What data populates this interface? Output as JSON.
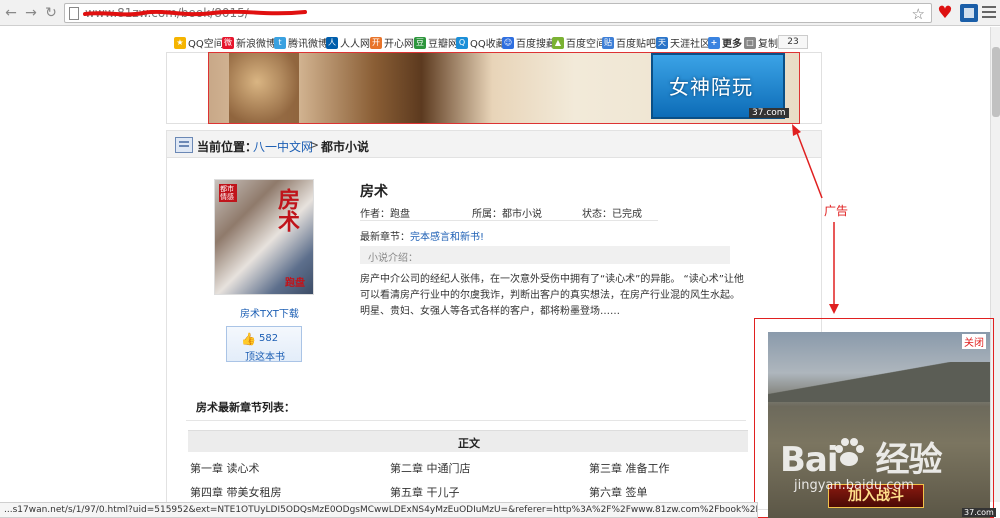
{
  "browser": {
    "url": "www.81zw.com/book/8015/",
    "status_url": "...s17wan.net/s/1/97/0.html?uid=515952&ext=NTE1OTUyLDI5ODQsMzE0ODgsMCwwLDExNS4yMzEuODIuMzU=&referer=http%3A%2F%2Fwww.81zw.com%2Fbook%2F8015%2F"
  },
  "share_bar": {
    "items": [
      "QQ空间",
      "新浪微博",
      "腾讯微博",
      "人人网",
      "开心网",
      "豆瓣网",
      "QQ收藏",
      "百度搜藏",
      "百度空间",
      "百度贴吧",
      "天涯社区",
      "更多",
      "复制"
    ],
    "count": "23"
  },
  "banner_ad": {
    "button_text": "女神陪玩",
    "tag": "37.com"
  },
  "breadcrumb": {
    "label": "当前位置：",
    "site": "八一中文网",
    "separator": ">",
    "category": "都市小说"
  },
  "book": {
    "title": "房术",
    "cover_title": "房术",
    "cover_author": "跑盘",
    "cover_badge": "都市情感",
    "author_label": "作者：跑盘",
    "category_label": "所属：都市小说",
    "status_label": "状态：已完成",
    "latest_label": "最新章节：",
    "latest_chapter": "完本感言和新书!",
    "intro_label": "小说介绍：",
    "intro": "房产中介公司的经纪人张伟，在一次意外受伤中拥有了“读心术”的异能。 “读心术”让他可以看清房产行业中的尔虞我诈，判断出客户的真实想法，在房产行业混的风生水起。 明星、贵妇、女强人等各式各样的客户，都将粉墨登场……",
    "download": "房术TXT下载",
    "votes": "582",
    "vote_label": "顶这本书"
  },
  "chapters": {
    "heading": "房术最新章节列表：",
    "section": "正文",
    "list": [
      "第一章 读心术",
      "第二章 中通门店",
      "第三章 准备工作",
      "第四章 带美女租房",
      "第五章 干儿子",
      "第六章 签单"
    ]
  },
  "annotation": {
    "label": "广告",
    "color": "#e02020"
  },
  "popup_ad": {
    "close": "关闭",
    "button": "加入战斗",
    "tag": "37.com"
  },
  "watermark": {
    "brand": "Bai",
    "brand_suffix": "经验",
    "domain": "jingyan.baidu.com"
  }
}
